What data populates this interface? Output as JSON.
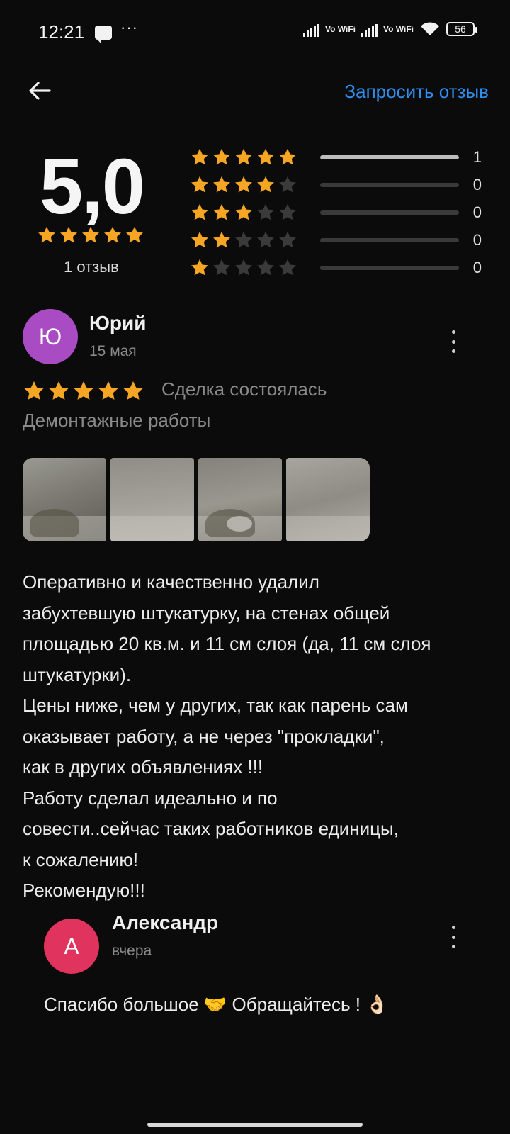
{
  "status_bar": {
    "time": "12:21",
    "icons": [
      "message-icon",
      "more-dots-icon",
      "signal-icon",
      "vowifi-icon",
      "signal-icon",
      "vowifi-icon",
      "wifi-icon",
      "battery-icon"
    ],
    "dots": "···",
    "vowifi_label": "Vo WiFi",
    "battery_level": "56"
  },
  "header": {
    "back_icon": "arrow-left-icon",
    "request_review_label": "Запросить отзыв"
  },
  "rating_summary": {
    "average": "5,0",
    "average_stars": 5,
    "review_count_label": "1 отзыв",
    "distribution": [
      {
        "stars": 5,
        "count": "1",
        "fraction": 1.0
      },
      {
        "stars": 4,
        "count": "0",
        "fraction": 0.0
      },
      {
        "stars": 3,
        "count": "0",
        "fraction": 0.0
      },
      {
        "stars": 2,
        "count": "0",
        "fraction": 0.0
      },
      {
        "stars": 1,
        "count": "0",
        "fraction": 0.0
      }
    ]
  },
  "review": {
    "avatar_letter": "Ю",
    "avatar_color": "#a94bc2",
    "author": "Юрий",
    "date": "15 мая",
    "rating": 5,
    "deal_status": "Сделка состоялась",
    "service": "Демонтажные работы",
    "photo_count": 4,
    "text": "Оперативно и качественно удалил\nзабухтевшую штукатурку, на стенах общей\nплощадью 20 кв.м. и 11 см слоя (да, 11 см слоя\nштукатурки).\nЦены ниже, чем у других, так как  парень сам\nоказывает работу, а не через \"прокладки\",\nкак в других объявлениях !!!\nРаботу сделал идеально и по\nсовести..сейчас таких работников единицы,\nк сожалению!\nРекомендую!!!"
  },
  "reply": {
    "avatar_letter": "А",
    "avatar_color": "#e0345e",
    "author": "Александр",
    "date": "вчера",
    "text": "Спасибо большое 🤝 Обращайтесь ! 👌🏻"
  },
  "colors": {
    "star_filled": "#f6a623",
    "star_empty": "#3a3a3a",
    "accent_link": "#2f8ff0",
    "background": "#0b0b0b"
  }
}
